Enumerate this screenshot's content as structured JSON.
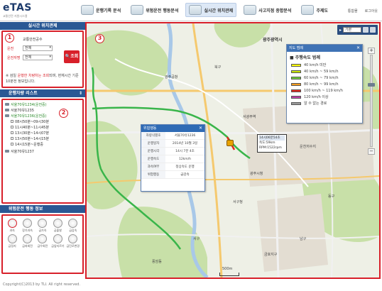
{
  "app": {
    "brand": "eTAS",
    "subtitle": "교통안전 지원시스템",
    "copyright": "Copyright(C)2013 by TLI. All right reserved."
  },
  "menu": {
    "items": [
      {
        "label": "운행기록 분석",
        "icon": "truck-icon",
        "active": false
      },
      {
        "label": "위험운전 행동분석",
        "icon": "car-icon",
        "active": false
      },
      {
        "label": "실시간 위치관제",
        "icon": "satellite-icon",
        "active": true
      },
      {
        "label": "사고지점 종합분석",
        "icon": "crash-icon",
        "active": false
      },
      {
        "label": "주제도",
        "icon": "map-icon",
        "active": false
      }
    ],
    "util": [
      "통합몰",
      "로그아웃"
    ]
  },
  "search": {
    "title": "실시간 위치관제",
    "badge": "1",
    "fields": [
      {
        "label": "교통안전공수",
        "value": ""
      },
      {
        "label": "운전",
        "value": "전체"
      },
      {
        "label": "운전자명",
        "value": "전체"
      }
    ],
    "button": "조회",
    "note_prefix": "※ 검일 ",
    "note_highlight": "운행한 차량차는 조회",
    "note_suffix": "되며, 현재시간 기준 10분전 정보입니다."
  },
  "vehicles": {
    "title": "운행차량 리스트",
    "badge": "2",
    "items": [
      {
        "label": "서울70유1234(운전중)",
        "highlight": true
      },
      {
        "label": "서울70유1235",
        "highlight": false
      },
      {
        "label": "서울70유1236(운전중)",
        "highlight": true
      }
    ],
    "time_rows": [
      "08시50분~09시30분",
      "11시40분~11시45분",
      "13시30분~14시07분",
      "13시50분~14시15분",
      "14시15분~운행중"
    ],
    "last": "서울70유1237"
  },
  "danger": {
    "title": "위험운전 행동 정보",
    "items": [
      "과속",
      "장기과속",
      "급가속",
      "급출발",
      "급감속",
      "급정지",
      "급좌회전",
      "급우회전",
      "급앞지르기",
      "급진로변경"
    ]
  },
  "map": {
    "badge": "3",
    "toolbar_select": "기본",
    "labels": [
      {
        "text": "광주광역시",
        "big": true
      },
      {
        "text": "광주공항",
        "big": false
      },
      {
        "text": "서광주역",
        "big": false
      },
      {
        "text": "운천저수지",
        "big": false
      },
      {
        "text": "광주시청",
        "big": false
      },
      {
        "text": "서구청",
        "big": false
      },
      {
        "text": "동구",
        "big": false
      },
      {
        "text": "남구",
        "big": false
      },
      {
        "text": "북구",
        "big": false
      },
      {
        "text": "서구",
        "big": false
      },
      {
        "text": "금호지구",
        "big": false
      },
      {
        "text": "풍암동",
        "big": false
      }
    ],
    "scale_label": "500m"
  },
  "legend": {
    "title": "지도 범례",
    "subtitle": "주행속도 범례",
    "rows": [
      {
        "label": "40 km/h 미만",
        "color": "#ffff00"
      },
      {
        "label": "40 km/h ~ 59 km/h",
        "color": "#c8e400"
      },
      {
        "label": "60 km/h ~ 79 km/h",
        "color": "#6fcf3a"
      },
      {
        "label": "80 km/h ~ 99 km/h",
        "color": "#f39c1f"
      },
      {
        "label": "100 km/h ~ 119 km/h",
        "color": "#e4281d"
      },
      {
        "label": "120 km/h 이상",
        "color": "#c040a8"
      },
      {
        "label": "알 수 없는 경로",
        "color": "#9b9b9b"
      }
    ]
  },
  "popup": {
    "title": "위험행동",
    "rows": [
      {
        "k": "차량식별호",
        "v": "서울70유1236"
      },
      {
        "k": "운행일자",
        "v": "2014년 10월 3일"
      },
      {
        "k": "운행시각",
        "v": "14시 7분 4초"
      },
      {
        "k": "운행속도",
        "v": "12km/h"
      },
      {
        "k": "과속여부",
        "v": "정상속도 운행"
      },
      {
        "k": "위험행동",
        "v": "급감속"
      }
    ]
  },
  "vehicle_tip": {
    "time": "14시06분54초",
    "speed": "속도:59km",
    "rpm": "RPM:1522rpm"
  }
}
